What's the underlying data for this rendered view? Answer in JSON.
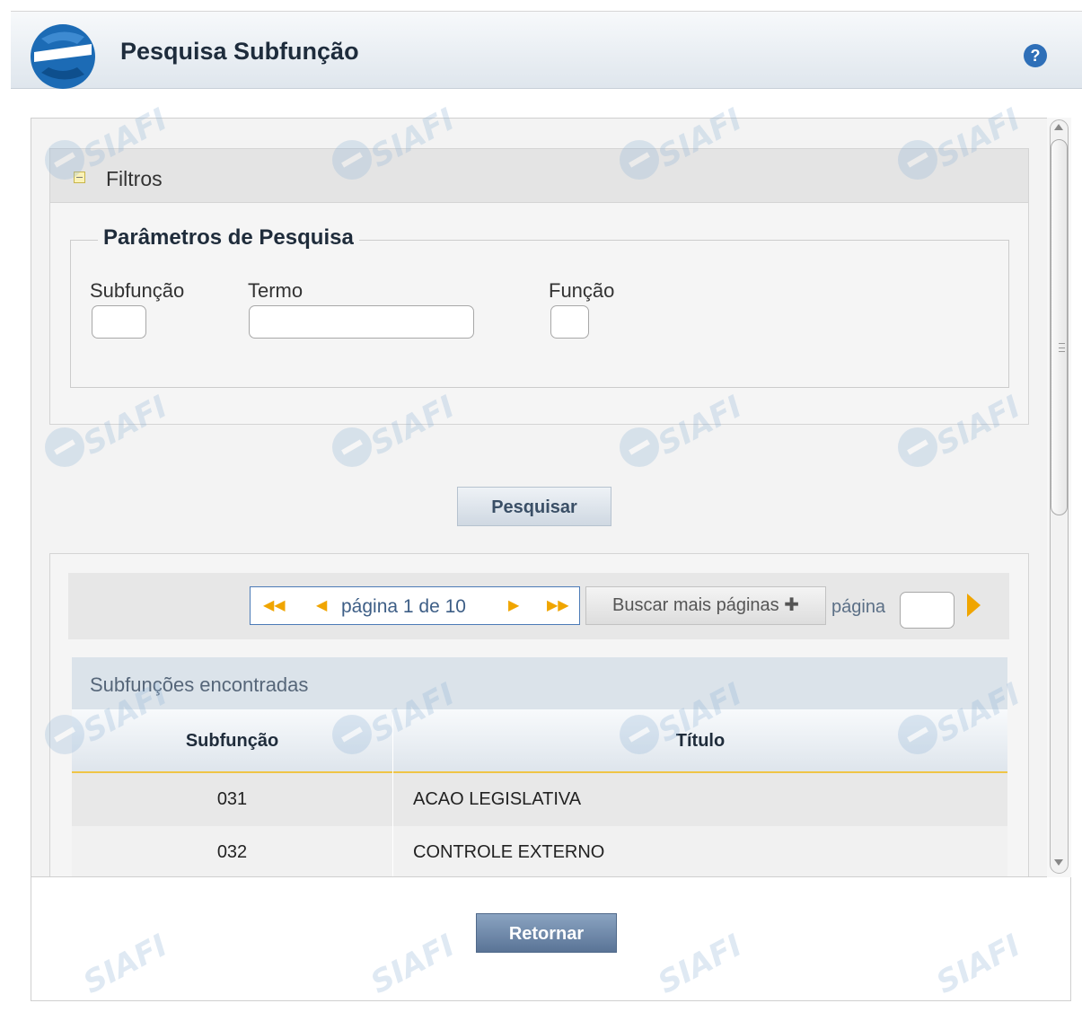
{
  "header": {
    "title": "Pesquisa Subfunção",
    "help_glyph": "?"
  },
  "filters": {
    "toggle_label": "Filtros",
    "params_title": "Parâmetros de Pesquisa",
    "fields": {
      "subfuncao_label": "Subfunção",
      "termo_label": "Termo",
      "funcao_label": "Função",
      "subfuncao_value": "",
      "termo_value": "",
      "funcao_value": ""
    }
  },
  "actions": {
    "search_label": "Pesquisar",
    "return_label": "Retornar"
  },
  "pager": {
    "text": "página 1 de 10",
    "more_pages_label": "Buscar mais páginas ✚",
    "page_label": "página",
    "page_value": ""
  },
  "results": {
    "caption": "Subfunções encontradas",
    "columns": [
      "Subfunção",
      "Título"
    ],
    "rows": [
      {
        "code": "031",
        "title": "ACAO LEGISLATIVA"
      },
      {
        "code": "032",
        "title": "CONTROLE EXTERNO"
      }
    ]
  },
  "watermark": {
    "text": "SIAFI"
  },
  "colors": {
    "accent": "#2e6fb8",
    "pager_arrow": "#f0a500",
    "header_underline": "#efc547"
  }
}
